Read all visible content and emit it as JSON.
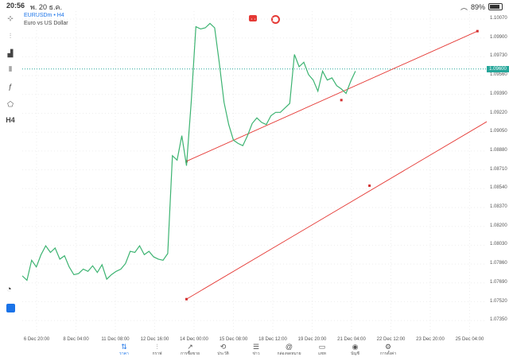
{
  "status": {
    "time": "20:56",
    "date": "พ. 20 ธ.ค.",
    "battery": "89%",
    "battery_level": 0.89
  },
  "symbol": {
    "name": "EURUSDm",
    "timeframe": "H4",
    "description": "Euro vs US Dollar"
  },
  "left_toolbar": [
    {
      "name": "crosshair-icon",
      "glyph": "⊹"
    },
    {
      "name": "candles-icon",
      "glyph": "⫶"
    },
    {
      "name": "bars-icon",
      "glyph": "▟"
    },
    {
      "name": "indicators-icon",
      "glyph": "⫴"
    },
    {
      "name": "function-icon",
      "glyph": "ƒ"
    },
    {
      "name": "shapes-icon",
      "glyph": "⬠"
    },
    {
      "name": "timeframe-label",
      "glyph": "H4"
    }
  ],
  "price_axis": {
    "ticks": [
      "1.10070",
      "1.09900",
      "1.09730",
      "1.09560",
      "1.09390",
      "1.09220",
      "1.09050",
      "1.08880",
      "1.08710",
      "1.08540",
      "1.08370",
      "1.08200",
      "1.08030",
      "1.07860",
      "1.07690",
      "1.07520",
      "1.07350"
    ],
    "current_price": "1.09600",
    "range": [
      1.0726,
      1.1012
    ]
  },
  "time_axis": {
    "labels": [
      "6 Dec 20:00",
      "8 Dec 04:00",
      "11 Dec 08:00",
      "12 Dec 16:00",
      "14 Dec 00:00",
      "15 Dec 08:00",
      "18 Dec 12:00",
      "19 Dec 20:00",
      "21 Dec 04:00",
      "22 Dec 12:00",
      "23 Dec 20:00",
      "25 Dec 04:00"
    ]
  },
  "chart_data": {
    "type": "line",
    "title": "",
    "xlabel": "",
    "ylabel": "",
    "ylim": [
      1.0726,
      1.1012
    ],
    "line_color": "#3cb371",
    "x": [
      0,
      1,
      2,
      3,
      4,
      5,
      6,
      7,
      8,
      9,
      10,
      11,
      12,
      13,
      14,
      15,
      16,
      17,
      18,
      19,
      20,
      21,
      22,
      23,
      24,
      25,
      26,
      27,
      28,
      29,
      30,
      31,
      32,
      33,
      34,
      35,
      36,
      37,
      38,
      39,
      40,
      41,
      42,
      43,
      44,
      45,
      46,
      47,
      48,
      49,
      50,
      51,
      52,
      53,
      54,
      55,
      56,
      57,
      58,
      59,
      60,
      61,
      62,
      63,
      64,
      65,
      66,
      67,
      68,
      69,
      70,
      71
    ],
    "y": [
      1.0774,
      1.077,
      1.0788,
      1.0782,
      1.0793,
      1.0801,
      1.0795,
      1.0799,
      1.0789,
      1.0792,
      1.0782,
      1.0775,
      1.0776,
      1.078,
      1.0778,
      1.0783,
      1.0777,
      1.0784,
      1.0771,
      1.0775,
      1.0778,
      1.078,
      1.0785,
      1.0796,
      1.0795,
      1.0801,
      1.0793,
      1.0796,
      1.0791,
      1.0789,
      1.0788,
      1.0794,
      1.0882,
      1.0878,
      1.09,
      1.0873,
      1.093,
      1.0998,
      1.0996,
      1.0997,
      1.1001,
      1.0997,
      1.0965,
      1.093,
      1.091,
      1.0896,
      1.0893,
      1.0891,
      1.09,
      1.0911,
      1.0916,
      1.0912,
      1.091,
      1.0918,
      1.0921,
      1.0921,
      1.0925,
      1.0929,
      1.0973,
      1.0962,
      1.0966,
      1.0955,
      1.095,
      1.094,
      1.0958,
      1.095,
      1.0952,
      1.0945,
      1.0942,
      1.0938,
      1.0949,
      1.0958
    ],
    "trendlines": [
      {
        "points": [
          [
            35,
            1.0877
          ],
          [
            68,
            1.0932
          ],
          [
            97,
            1.0994
          ]
        ],
        "color": "#e53935"
      },
      {
        "points": [
          [
            35,
            1.0753
          ],
          [
            74,
            1.0855
          ],
          [
            120,
            1.0965
          ]
        ],
        "color": "#e53935"
      }
    ],
    "current_price_line": {
      "value": 1.096,
      "color": "#26a69a"
    }
  },
  "bottom_nav": [
    {
      "name": "nav-quotes",
      "icon": "⇅",
      "label": "ราคา",
      "active": true
    },
    {
      "name": "nav-chart",
      "icon": "⫶",
      "label": "กราฟ",
      "active": false
    },
    {
      "name": "nav-trade",
      "icon": "↗",
      "label": "การซื้อขาย",
      "active": false
    },
    {
      "name": "nav-history",
      "icon": "⟲",
      "label": "ประวัติ",
      "active": false
    },
    {
      "name": "nav-news",
      "icon": "☰",
      "label": "ข่าว",
      "active": false
    },
    {
      "name": "nav-mailbox",
      "icon": "@",
      "label": "กล่องจดหมาย",
      "active": false
    },
    {
      "name": "nav-chat",
      "icon": "▭",
      "label": "แชท",
      "active": false
    },
    {
      "name": "nav-account",
      "icon": "◉",
      "label": "บัญชี",
      "active": false
    },
    {
      "name": "nav-settings",
      "icon": "⚙",
      "label": "การตั้งค่า",
      "active": false
    }
  ]
}
